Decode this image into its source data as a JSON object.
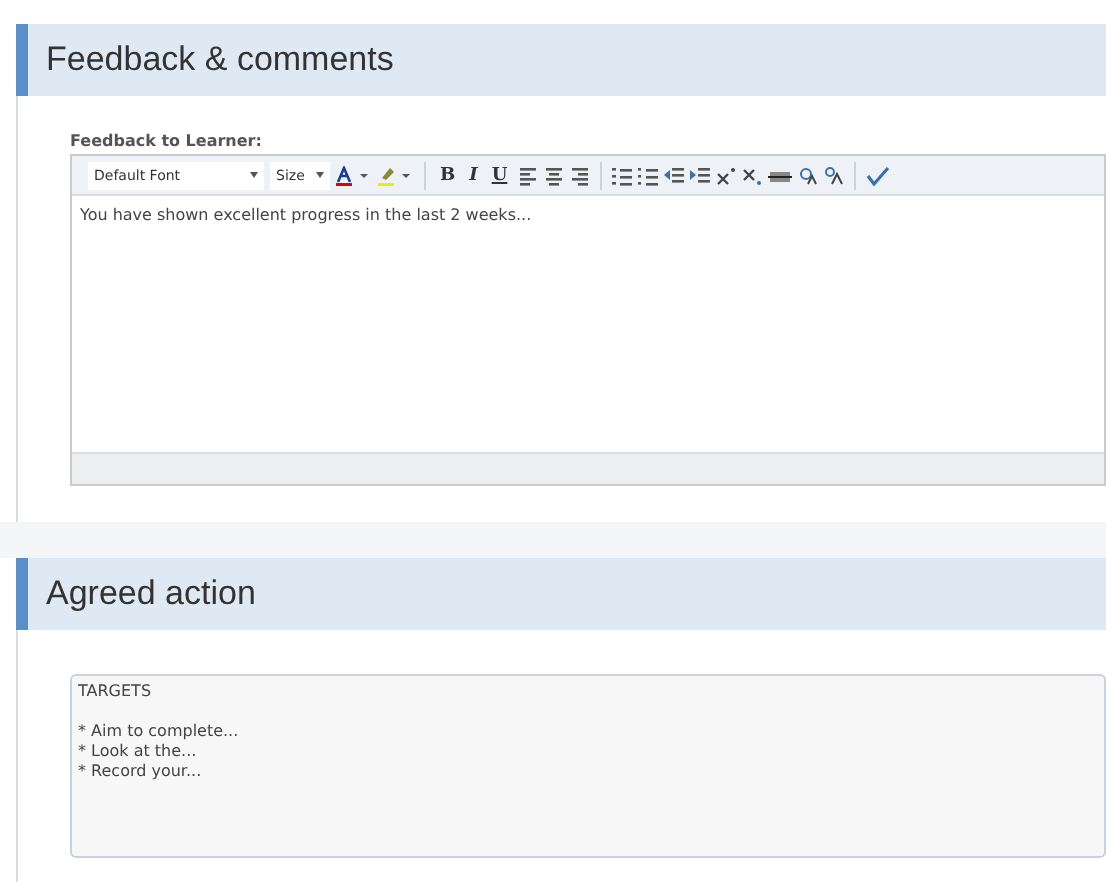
{
  "sections": [
    {
      "kind": "editor",
      "title": "Feedback & comments",
      "field_label": "Feedback to Learner:",
      "font_select": "Default Font",
      "size_select": "Size",
      "format_buttons": [
        "B",
        "I",
        "U"
      ],
      "value": "You have shown excellent progress in the last 2 weeks..."
    },
    {
      "kind": "textarea",
      "title": "Agreed action",
      "heading": "TARGETS",
      "lines": [
        "* Aim to complete...",
        "* Look at the...",
        "* Record your..."
      ]
    }
  ]
}
